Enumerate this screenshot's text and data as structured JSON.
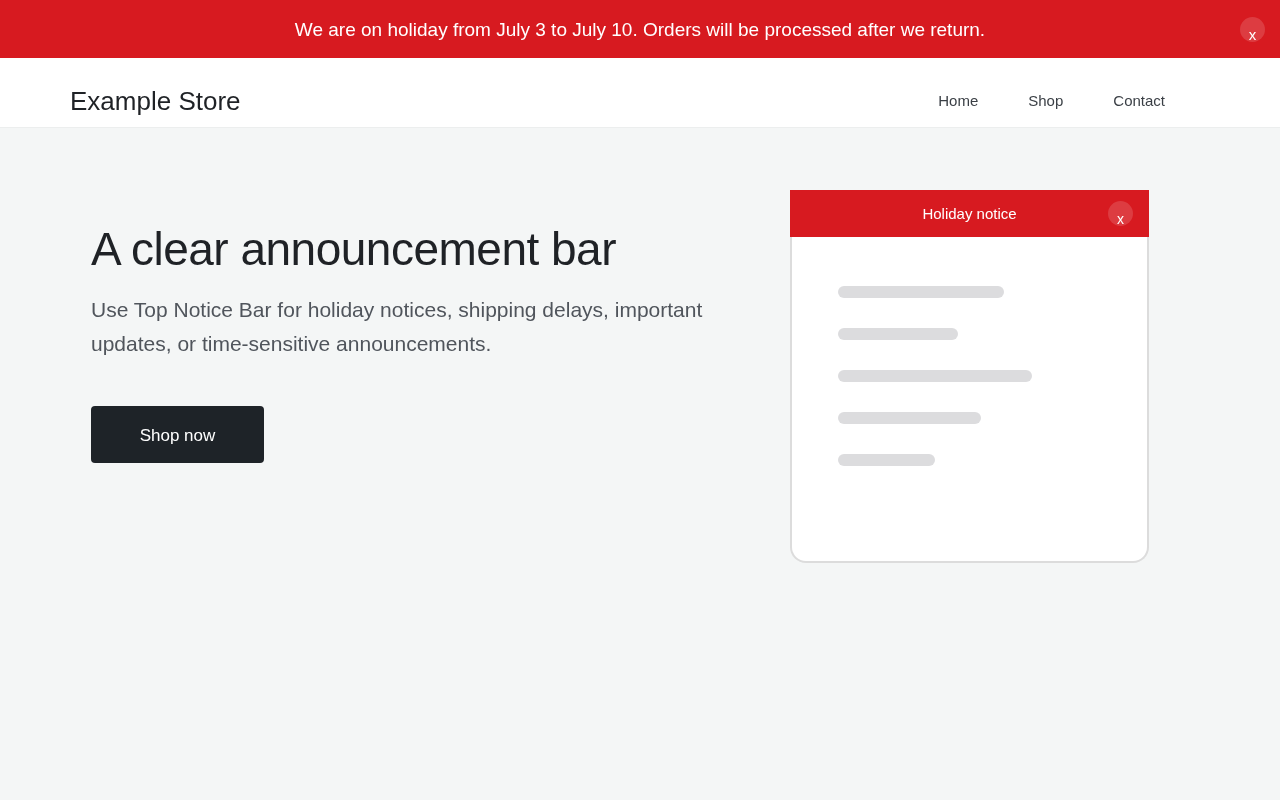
{
  "notice_bar": {
    "message": "We are on holiday from July 3 to July 10. Orders will be processed after we return.",
    "close_label": "x"
  },
  "header": {
    "brand": "Example Store",
    "nav": [
      {
        "label": "Home"
      },
      {
        "label": "Shop"
      },
      {
        "label": "Contact"
      }
    ]
  },
  "hero": {
    "heading": "A clear announcement bar",
    "description": "Use Top Notice Bar for holiday notices, shipping delays, important updates, or time-sensitive announcements.",
    "button": "Shop now"
  },
  "preview": {
    "title": "Holiday notice",
    "close_label": "x"
  }
}
